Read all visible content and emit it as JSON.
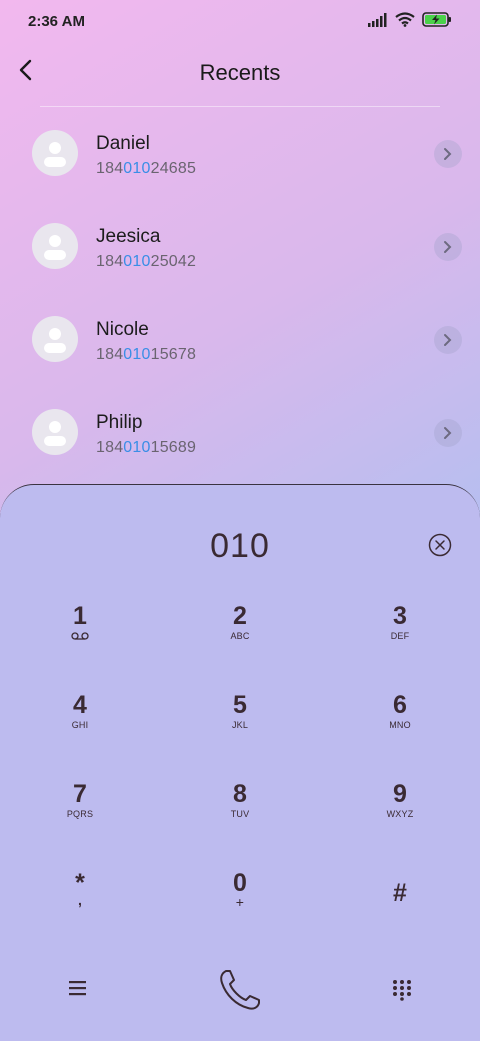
{
  "status_bar": {
    "time": "2:36 AM"
  },
  "header": {
    "title": "Recents"
  },
  "recents": [
    {
      "name": "Daniel",
      "number_prefix": "184",
      "number_match": "010",
      "number_suffix": "24685"
    },
    {
      "name": "Jeesica",
      "number_prefix": "184",
      "number_match": "010",
      "number_suffix": "25042"
    },
    {
      "name": "Nicole",
      "number_prefix": "184",
      "number_match": "010",
      "number_suffix": "15678"
    },
    {
      "name": "Philip",
      "number_prefix": "184",
      "number_match": "010",
      "number_suffix": "15689"
    }
  ],
  "dialer": {
    "input": "010",
    "keys": [
      {
        "digit": "1",
        "letters": ""
      },
      {
        "digit": "2",
        "letters": "ABC"
      },
      {
        "digit": "3",
        "letters": "DEF"
      },
      {
        "digit": "4",
        "letters": "GHI"
      },
      {
        "digit": "5",
        "letters": "JKL"
      },
      {
        "digit": "6",
        "letters": "MNO"
      },
      {
        "digit": "7",
        "letters": "PQRS"
      },
      {
        "digit": "8",
        "letters": "TUV"
      },
      {
        "digit": "9",
        "letters": "WXYZ"
      },
      {
        "digit": "*",
        "letters": ","
      },
      {
        "digit": "0",
        "letters": "+"
      },
      {
        "digit": "#",
        "letters": ""
      }
    ]
  },
  "icons": {
    "signal": "signal-icon",
    "wifi": "wifi-icon",
    "battery": "battery-charging-icon",
    "back": "chevron-left-icon",
    "voicemail": "voicemail-icon",
    "backspace": "backspace-icon",
    "menu": "menu-icon",
    "call": "phone-icon",
    "keypad": "dialpad-icon"
  },
  "colors": {
    "highlight": "#3a8ee6",
    "dialpad_bg": "#bdbbef",
    "key_text": "#3a2a33"
  }
}
